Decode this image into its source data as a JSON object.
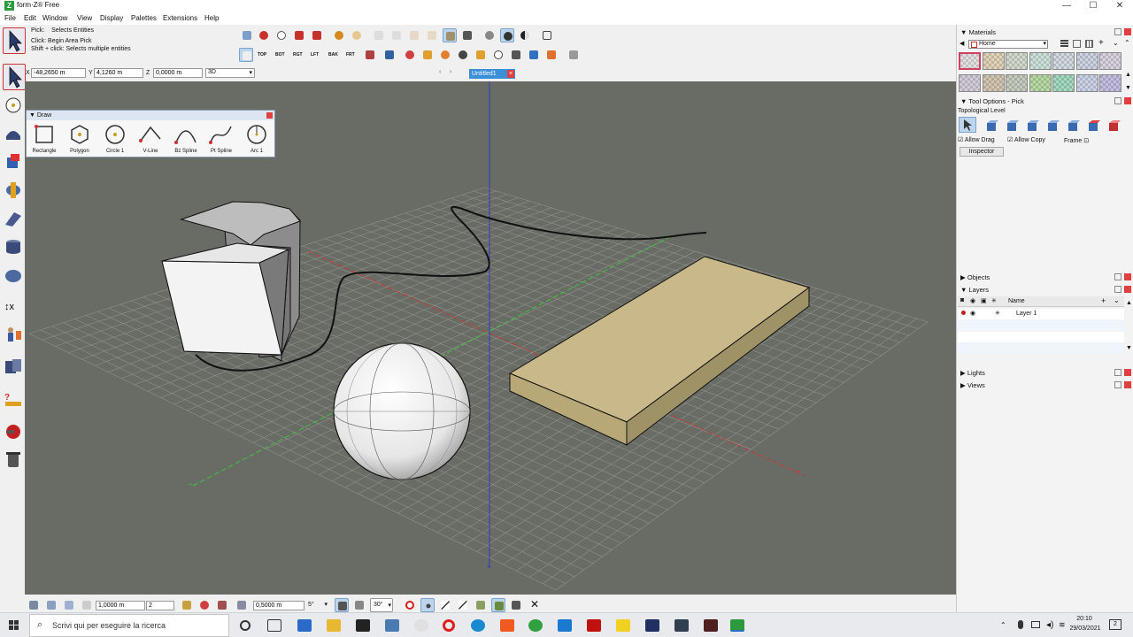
{
  "app": {
    "title": "form·Z® Free"
  },
  "window_controls": {
    "minimize": "—",
    "maximize": "☐",
    "close": "✕"
  },
  "menu": [
    "File",
    "Edit",
    "Window",
    "View",
    "Display",
    "Palettes",
    "Extensions",
    "Help"
  ],
  "pick_hint": {
    "line1_label": "Pick:",
    "line1_value": "Selects Entities",
    "line2": "Click: Begin Area Pick",
    "line3": "Shift + click: Selects multiple entities"
  },
  "view_buttons": [
    "TOP",
    "BOT",
    "RGT",
    "LFT",
    "BAK",
    "FRT"
  ],
  "coords": {
    "x_label": "X",
    "x": "-48,2650 m",
    "y_label": "Y",
    "y": "4,1260 m",
    "z_label": "Z",
    "z": "0,0000 m",
    "mode": "3D"
  },
  "document_tab": {
    "name": "Untitled1"
  },
  "draw_palette": {
    "title": "Draw",
    "tools": [
      "Rectangle",
      "Polygon",
      "Circle 1",
      "V-Line",
      "Bz Spline",
      "Pt Spline",
      "Arc 1"
    ]
  },
  "right_panel": {
    "materials": {
      "title": "Materials",
      "folder": "Home"
    },
    "tool_options": {
      "title": "Tool Options - Pick",
      "topological_level": "Topological Level",
      "allow_drag": "Allow Drag",
      "allow_copy": "Allow Copy",
      "frame": "Frame",
      "inspector": "Inspector"
    },
    "objects": "Objects",
    "layers": {
      "title": "Layers",
      "col_name": "Name",
      "rows": [
        "Layer 1"
      ]
    },
    "lights": "Lights",
    "views": "Views"
  },
  "bottom_bar": {
    "grid_size": "1,0000 m",
    "grid_divisions": "2",
    "snap_distance": "0,5000 m",
    "angle1": "5°",
    "angle2": "30°"
  },
  "taskbar": {
    "search_placeholder": "Scrivi qui per eseguire la ricerca",
    "time": "20:10",
    "date": "29/03/2021",
    "notifications": "2"
  },
  "colors": {
    "accent": "#3b8fd9",
    "viewport_bg": "#686c64",
    "grid": "#8e928a",
    "x_axis": "#c83a3a",
    "y_axis": "#3ec43e",
    "z_axis": "#2c3cb8",
    "slab": "#c9b98a"
  }
}
